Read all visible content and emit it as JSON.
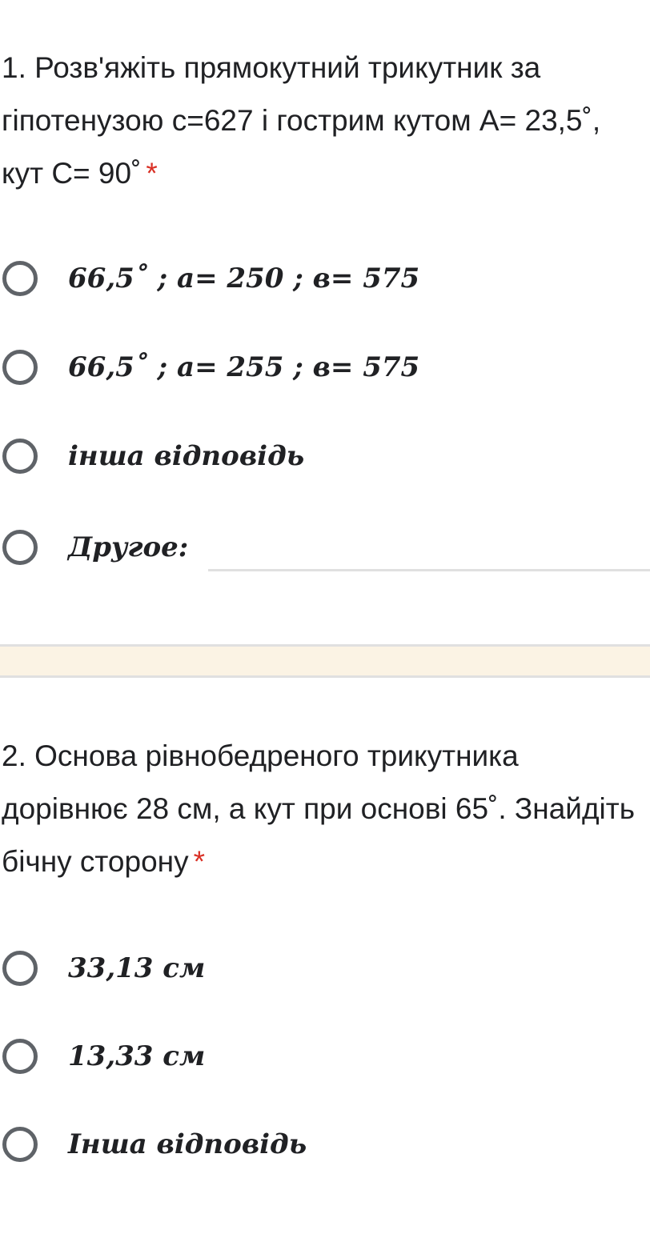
{
  "colors": {
    "text": "#202124",
    "required_star": "#d93025",
    "radio_border": "#5f6368",
    "divider_band": "#fbf3e4",
    "divider_line": "#e0e0e0"
  },
  "questions": [
    {
      "title": "1. Розв'яжіть прямокутний трикутник за гіпотенузою с=627 і гострим кутом А= 23,5˚, кут С= 90˚",
      "required_mark": "*",
      "options": [
        {
          "label": "66,5˚ ; a= 250 ; в= 575",
          "selected": false
        },
        {
          "label": "66,5˚ ; a= 255 ; в= 575",
          "selected": false
        },
        {
          "label": "інша відповідь",
          "selected": false
        },
        {
          "label": "Другое:",
          "selected": false,
          "has_text_input": true,
          "input_value": ""
        }
      ]
    },
    {
      "title": "2. Основа рівнобедреного трикутника дорівнює 28 см, а кут при основі 65˚. Знайдіть бічну сторону",
      "required_mark": "*",
      "options": [
        {
          "label": "33,13 см",
          "selected": false
        },
        {
          "label": "13,33 см",
          "selected": false
        },
        {
          "label": "Інша відповідь",
          "selected": false
        }
      ]
    }
  ]
}
